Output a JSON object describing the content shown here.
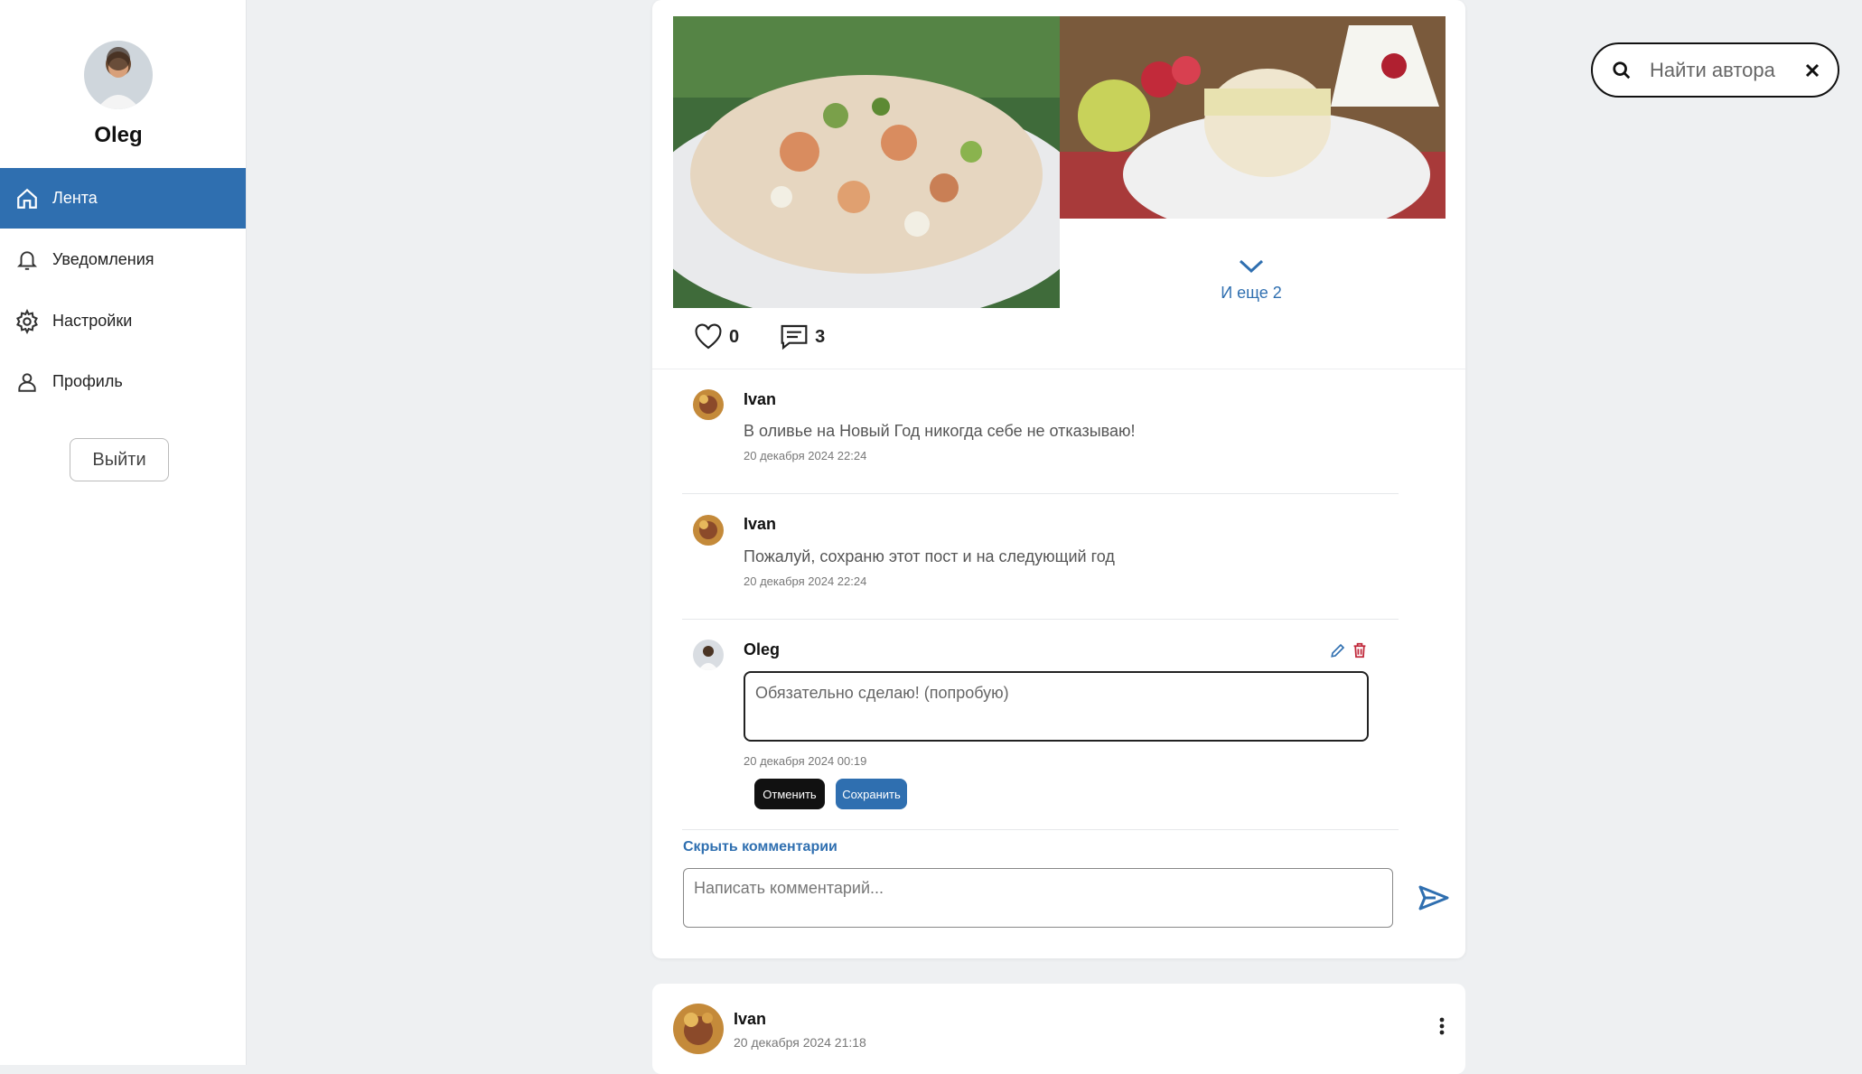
{
  "sidebar": {
    "user_name": "Oleg",
    "items": [
      {
        "label": "Лента",
        "icon": "home-icon",
        "active": true
      },
      {
        "label": "Уведомления",
        "icon": "bell-icon",
        "active": false
      },
      {
        "label": "Настройки",
        "icon": "gear-icon",
        "active": false
      },
      {
        "label": "Профиль",
        "icon": "user-icon",
        "active": false
      }
    ],
    "logout_label": "Выйти"
  },
  "post": {
    "more_photos_label": "И еще 2",
    "likes_count": "0",
    "comments_count": "3",
    "comments": [
      {
        "author": "Ivan",
        "text": "В оливье на Новый Год никогда себе не отказываю!",
        "date": "20 декабря 2024 22:24"
      },
      {
        "author": "Ivan",
        "text": "Пожалуй, сохраню этот пост и на следующий год",
        "date": "20 декабря 2024 22:24"
      },
      {
        "author": "Oleg",
        "edit_value": "Обязательно сделаю! (попробую)",
        "date": "20 декабря 2024 00:19",
        "cancel_label": "Отменить",
        "save_label": "Сохранить"
      }
    ],
    "hide_comments_label": "Скрыть комментарии",
    "comment_placeholder": "Написать комментарий..."
  },
  "search": {
    "placeholder": "Найти автора"
  },
  "next_post": {
    "author": "Ivan",
    "date": "20 декабря 2024 21:18"
  },
  "colors": {
    "accent": "#2f6fb0",
    "background": "#eef0f2"
  }
}
